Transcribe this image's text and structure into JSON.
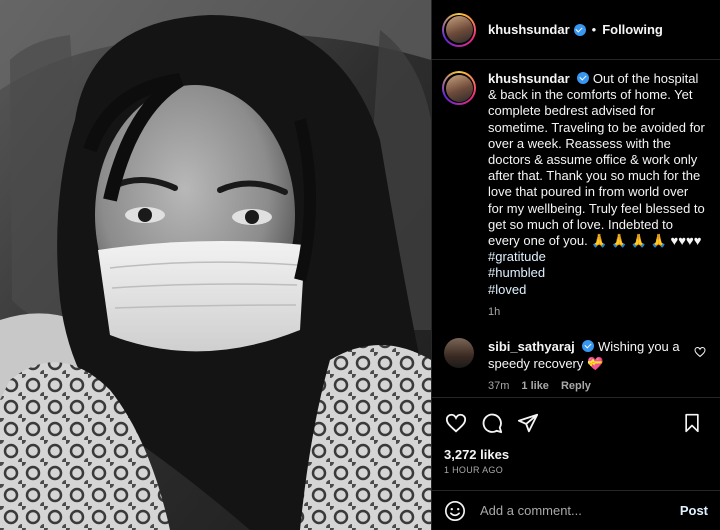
{
  "post": {
    "author": "khushsundar",
    "follow_status": "Following",
    "separator": "•",
    "caption": {
      "username": "khushsundar",
      "text": "Out of the hospital & back in the comforts of home. Yet complete bedrest advised for sometime. Traveling to be avoided for over a week. Reassess with the doctors & assume office & work only after that. Thank you so much for the love that poured in from world over for my wellbeing. Truly feel blessed to get so much of love. Indebted to every one of you. 🙏 🙏 🙏 🙏 ♥♥♥♥",
      "hashtags": [
        "#gratitude",
        "#humbled",
        "#loved"
      ],
      "time": "1h"
    },
    "comments": [
      {
        "username": "sibi_sathyaraj",
        "text": "Wishing you a speedy recovery 💝",
        "time": "37m",
        "likes": "1 like",
        "reply_label": "Reply"
      }
    ],
    "likes_label": "3,272 likes",
    "age_label": "1 HOUR AGO"
  },
  "comment_box": {
    "placeholder": "Add a comment...",
    "post_label": "Post"
  },
  "icons": {
    "like": "heart-icon",
    "comment": "comment-icon",
    "share": "paper-plane-icon",
    "save": "bookmark-icon",
    "emoji": "smiley-icon",
    "verified": "verified-badge-icon"
  },
  "colors": {
    "background": "#000000",
    "border": "#262626",
    "secondary_text": "#a8a8a8",
    "verified_blue": "#3897f0",
    "link_text": "#e0f1ff"
  }
}
